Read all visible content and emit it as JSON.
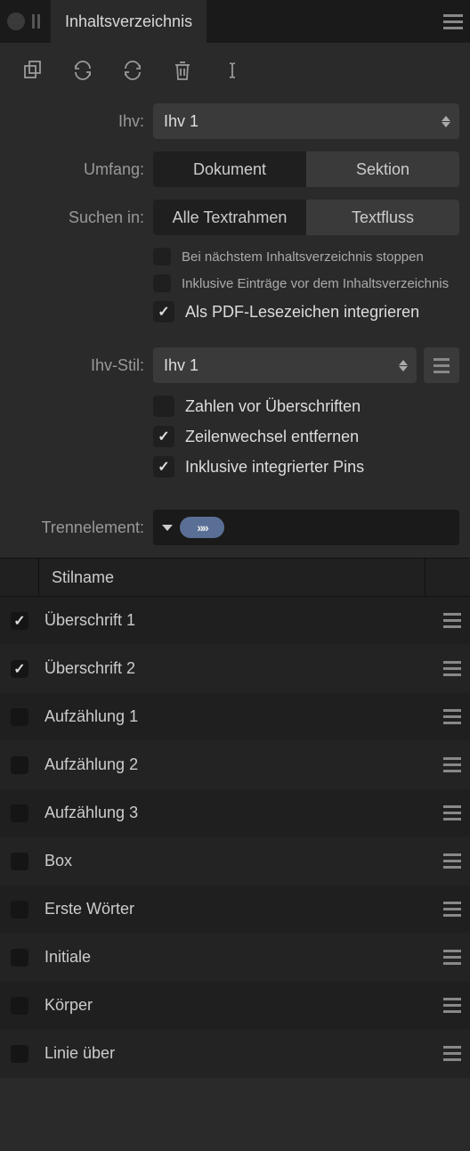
{
  "header": {
    "tab_title": "Inhaltsverzeichnis"
  },
  "form": {
    "ihv_label": "Ihv:",
    "ihv_value": "Ihv 1",
    "umfang_label": "Umfang:",
    "umfang_options": {
      "dokument": "Dokument",
      "sektion": "Sektion"
    },
    "umfang_active": "dokument",
    "suchen_label": "Suchen in:",
    "suchen_options": {
      "alle": "Alle Textrahmen",
      "textfluss": "Textfluss"
    },
    "suchen_active": "alle",
    "stop_next_toc": {
      "checked": false,
      "label": "Bei nächstem Inhaltsverzeichnis stoppen"
    },
    "include_before_toc": {
      "checked": false,
      "label": "Inklusive Einträge vor dem Inhaltsverzeichnis"
    },
    "pdf_bookmark": {
      "checked": true,
      "label": "Als PDF-Lesezeichen integrieren"
    },
    "ihv_stil_label": "Ihv-Stil:",
    "ihv_stil_value": "Ihv 1",
    "numbers_before_headings": {
      "checked": false,
      "label": "Zahlen vor Überschriften"
    },
    "remove_linebreaks": {
      "checked": true,
      "label": "Zeilenwechsel entfernen"
    },
    "include_pins": {
      "checked": true,
      "label": "Inklusive integrierter Pins"
    },
    "separator_label": "Trennelement:",
    "separator_symbol": "»»"
  },
  "table": {
    "column_header": "Stilname",
    "rows": [
      {
        "checked": true,
        "name": "Überschrift 1"
      },
      {
        "checked": true,
        "name": "Überschrift 2"
      },
      {
        "checked": false,
        "name": "Aufzählung 1"
      },
      {
        "checked": false,
        "name": "Aufzählung 2"
      },
      {
        "checked": false,
        "name": "Aufzählung 3"
      },
      {
        "checked": false,
        "name": "Box"
      },
      {
        "checked": false,
        "name": "Erste Wörter"
      },
      {
        "checked": false,
        "name": "Initiale"
      },
      {
        "checked": false,
        "name": "Körper"
      },
      {
        "checked": false,
        "name": "Linie über"
      }
    ]
  }
}
